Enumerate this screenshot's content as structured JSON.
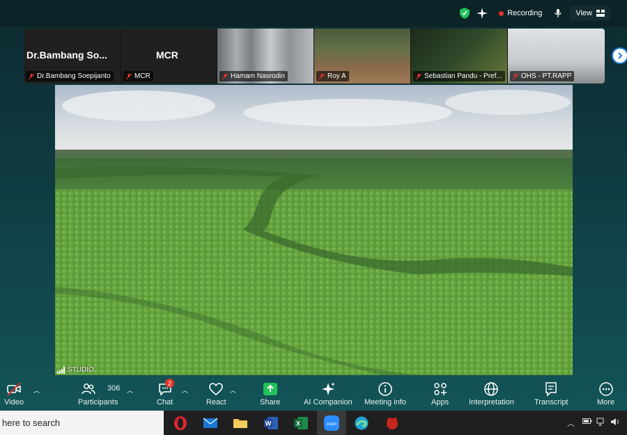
{
  "top_bar": {
    "recording_label": "Recording",
    "view_label": "View"
  },
  "thumbnails": [
    {
      "big_name": "Dr.Bambang  So...",
      "label": "Dr.Bambang Soepijanto"
    },
    {
      "big_name": "MCR",
      "label": "MCR"
    },
    {
      "label": "Hamam Nasrodin"
    },
    {
      "label": "Roy A"
    },
    {
      "label": "Sebastian Pandu - Pref..."
    },
    {
      "label": "OHS - PT.RAPP"
    }
  ],
  "main_video": {
    "studio_label": "STUDIO"
  },
  "toolbar": {
    "video": "Video",
    "participants": "Participants",
    "participants_count": "306",
    "chat": "Chat",
    "chat_badge": "2",
    "react": "React",
    "share": "Share",
    "ai_companion": "AI Companion",
    "meeting_info": "Meeting info",
    "apps": "Apps",
    "interpretation": "Interpretation",
    "transcript": "Transcript",
    "more": "More"
  },
  "taskbar": {
    "search_text": "here to search",
    "zoom_label": "zoom"
  },
  "colors": {
    "accent_green": "#22c35a",
    "record_red": "#e0352b",
    "link_blue": "#1d7bd8"
  }
}
